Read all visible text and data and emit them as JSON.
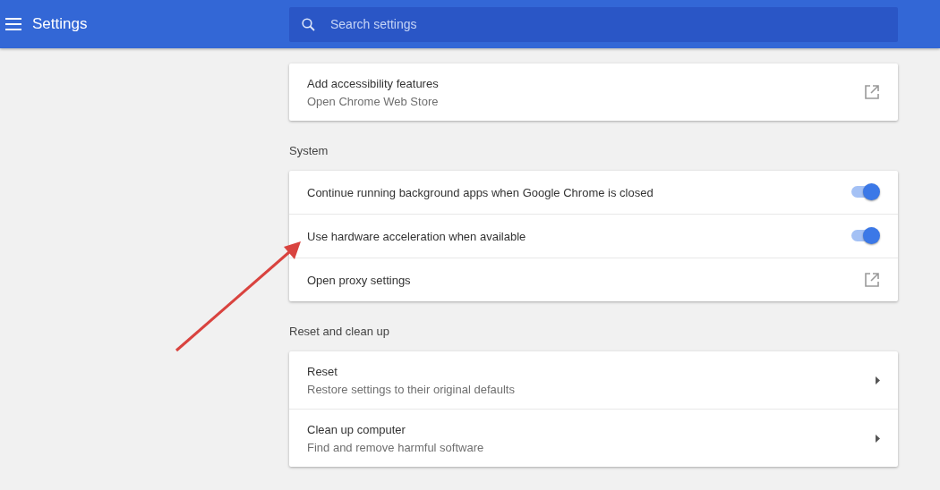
{
  "header": {
    "title": "Settings",
    "search": {
      "placeholder": "Search settings"
    }
  },
  "sections": [
    {
      "rows": [
        {
          "kind": "external",
          "label": "Add accessibility features",
          "sublabel": "Open Chrome Web Store"
        }
      ]
    },
    {
      "title": "System",
      "rows": [
        {
          "kind": "toggle",
          "label": "Continue running background apps when Google Chrome is closed",
          "on": true
        },
        {
          "kind": "toggle",
          "label": "Use hardware acceleration when available",
          "on": true
        },
        {
          "kind": "external",
          "label": "Open proxy settings"
        }
      ]
    },
    {
      "title": "Reset and clean up",
      "rows": [
        {
          "kind": "submenu",
          "label": "Reset",
          "sublabel": "Restore settings to their original defaults"
        },
        {
          "kind": "submenu",
          "label": "Clean up computer",
          "sublabel": "Find and remove harmful software"
        }
      ]
    }
  ],
  "annotation": {
    "kind": "arrow",
    "color": "#d9433f"
  }
}
